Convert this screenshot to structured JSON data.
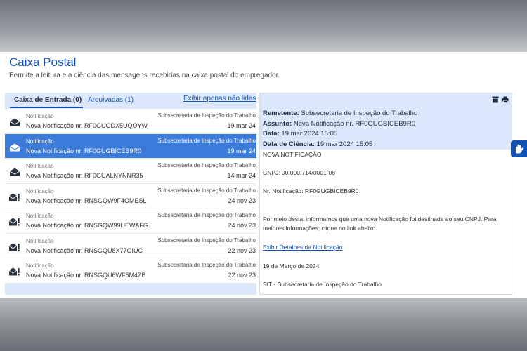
{
  "page": {
    "title": "Caixa Postal",
    "subtitle": "Permite a leitura e a ciência das mensagens recebidas na caixa postal do empregador."
  },
  "tabs": {
    "inbox": "Caixa de Entrada (0)",
    "archived": "Arquivadas (1)",
    "filter_link": "Exibir apenas não lidas"
  },
  "messages": [
    {
      "icon": "envelope-open-icon",
      "type": "Notificação",
      "subject": "Nova Notificação nr. RF0GUGDX5UQOYW",
      "sender": "Subsecretaria de Inspeção do Trabalho",
      "date": "19 mar 24"
    },
    {
      "icon": "envelope-open-icon",
      "type": "Notificação",
      "subject": "Nova Notificação nr. RF0GUGBICEB9R0",
      "sender": "Subsecretaria de Inspeção do Trabalho",
      "date": "19 mar 24",
      "selected": true
    },
    {
      "icon": "envelope-open-icon",
      "type": "Notificação",
      "subject": "Nova Notificação nr. RF0GUALNYNNR35",
      "sender": "Subsecretaria de Inspeção do Trabalho",
      "date": "14 mar 24"
    },
    {
      "icon": "envelope-alert-icon",
      "type": "Notificação",
      "subject": "Nova Notificação nr. RNSGQW9F4OMESL",
      "sender": "Subsecretaria de Inspeção do Trabalho",
      "date": "24 nov 23"
    },
    {
      "icon": "envelope-alert-icon",
      "type": "Notificação",
      "subject": "Nova Notificação nr. RNSGQW99HEWAFG",
      "sender": "Subsecretaria de Inspeção do Trabalho",
      "date": "24 nov 23"
    },
    {
      "icon": "envelope-alert-icon",
      "type": "Notificação",
      "subject": "Nova Notificação nr. RNSGQU8X77OIUC",
      "sender": "Subsecretaria de Inspeção do Trabalho",
      "date": "22 nov 23"
    },
    {
      "icon": "envelope-alert-icon",
      "type": "Notificação",
      "subject": "Nova Notificação nr. RNSGQU6WF5M4ZB",
      "sender": "Subsecretaria de Inspeção do Trabalho",
      "date": "22 nov 23"
    }
  ],
  "detail": {
    "sender_label": "Remetente:",
    "sender_value": "Subsecretaria de Inspeção do Trabalho",
    "subject_label": "Assunto:",
    "subject_value": "Nova Notificação nr. RF0GUGBICEB9R0",
    "date_label": "Data:",
    "date_value": "19 mar 2024 15:05",
    "science_label": "Data de Ciência:",
    "science_value": "19 mar 2024 15:05",
    "body": {
      "heading": "NOVA NOTIFICAÇÃO",
      "cnpj": "CNPJ: 00.000.714/0001-08",
      "notification_nr": "Nr. Notificação: RF0GUGBICEB9R0",
      "paragraph_line1": "Por meio desta, informamos que uma nova Notificação foi destinada ao seu CNPJ. Para",
      "paragraph_line2": "maiores informações, clique no link abaixo.",
      "link": "Exibir Detalhes da Notificação",
      "date": "19 de Março de 2024",
      "signature": "SIT - Subsecretaria de Inspeção do Trabalho"
    }
  },
  "colors": {
    "accent": "#1351b4",
    "selected_row": "#3d7bd8",
    "panel_bg": "#dbe8fb"
  }
}
